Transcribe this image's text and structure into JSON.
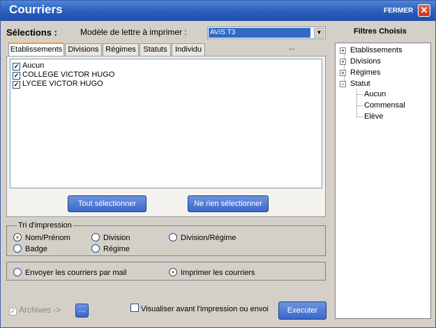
{
  "window": {
    "title": "Courriers",
    "close_label": "FERMER",
    "close_glyph": "✕"
  },
  "header": {
    "selections_label": "Sélections :",
    "model_label": "Modèle de lettre à imprimer :",
    "model_value": "AVIS T3"
  },
  "tabs": [
    {
      "label": "Etablissements",
      "active": true
    },
    {
      "label": "Divisions",
      "active": false
    },
    {
      "label": "Régimes",
      "active": false
    },
    {
      "label": "Statuts",
      "active": false
    },
    {
      "label": "Individu",
      "active": false
    }
  ],
  "tabs_more": "...",
  "list_items": [
    {
      "label": "Aucun",
      "checked": true
    },
    {
      "label": "COLLEGE VICTOR HUGO",
      "checked": true
    },
    {
      "label": "LYCEE VICTOR HUGO",
      "checked": true
    }
  ],
  "buttons": {
    "select_all": "Tout sélectionner",
    "select_none": "Ne rien sélectionner",
    "execute": "Executer",
    "browse": "..."
  },
  "sort": {
    "legend": "Tri d'impression",
    "options": [
      {
        "label": "Nom/Prénom",
        "selected": true
      },
      {
        "label": "Division",
        "selected": false
      },
      {
        "label": "Division/Régime",
        "selected": false
      },
      {
        "label": "Badge",
        "selected": false
      },
      {
        "label": "Régime",
        "selected": false
      }
    ]
  },
  "output": {
    "options": [
      {
        "label": "Envoyer les courriers par mail",
        "selected": false
      },
      {
        "label": "Imprimer les courriers",
        "selected": true
      }
    ]
  },
  "footer": {
    "archives_label": "Archives ->",
    "archives_checked": true,
    "preview_label": "Visualiser avant l'impression ou envoi",
    "preview_checked": false
  },
  "filters": {
    "title": "Filtres Choisis",
    "nodes": [
      {
        "label": "Etablissements",
        "toggle": "+"
      },
      {
        "label": "Divisions",
        "toggle": "+"
      },
      {
        "label": "Régimes",
        "toggle": "+"
      },
      {
        "label": "Statut",
        "toggle": "−"
      }
    ],
    "statut_children": [
      "Aucun",
      "Commensal",
      "Elève"
    ]
  },
  "colors": {
    "titlebar": "#2a5fbf",
    "accent_button": "#3b68c9",
    "selection": "#316ac5",
    "close": "#c8321a"
  }
}
